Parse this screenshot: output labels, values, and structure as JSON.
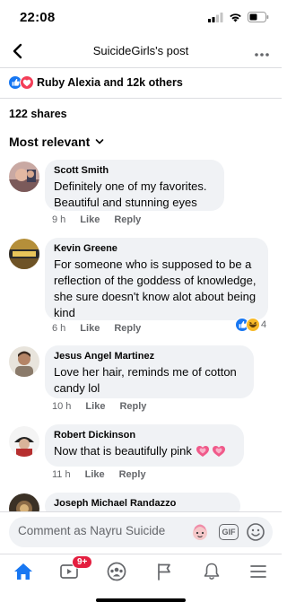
{
  "status_bar": {
    "time": "22:08"
  },
  "header": {
    "title": "SuicideGirls's post"
  },
  "reactions": {
    "summary": "Ruby Alexia and 12k others",
    "shares": "122 shares"
  },
  "sort": {
    "label": "Most relevant"
  },
  "comments": [
    {
      "name": "Scott Smith",
      "text": "Definitely one of my favorites. Beautiful and stunning eyes",
      "time": "9 h",
      "like": "Like",
      "reply": "Reply"
    },
    {
      "name": "Kevin Greene",
      "text": "For someone who is supposed to be a reflection of the goddess of knowledge, she sure doesn't know alot about being kind",
      "time": "6 h",
      "like": "Like",
      "reply": "Reply",
      "reaction_count": "4"
    },
    {
      "name": "Jesus Angel Martinez",
      "text": "Love her hair, reminds me of cotton candy lol",
      "time": "10 h",
      "like": "Like",
      "reply": "Reply"
    },
    {
      "name": "Robert Dickinson",
      "text": "Now that is beautifully pink",
      "time": "11 h",
      "like": "Like",
      "reply": "Reply"
    },
    {
      "name": "Joseph Michael Randazzo"
    }
  ],
  "composer": {
    "placeholder": "Comment as Nayru Suicide",
    "gif_label": "GIF"
  },
  "tabbar": {
    "video_badge": "9+"
  },
  "colors": {
    "facebook_blue": "#1877f2",
    "love_red": "#f33e58",
    "badge_red": "#e41e3f",
    "bubble_gray": "#f0f2f5",
    "meta_gray": "#65676b"
  },
  "icons": [
    "back-arrow-icon",
    "more-icon",
    "like-reaction-icon",
    "love-reaction-icon",
    "haha-reaction-icon",
    "chevron-down-icon",
    "sticker-icon",
    "gif-icon",
    "emoji-icon",
    "home-icon",
    "video-icon",
    "groups-icon",
    "flag-icon",
    "bell-icon",
    "menu-icon"
  ]
}
